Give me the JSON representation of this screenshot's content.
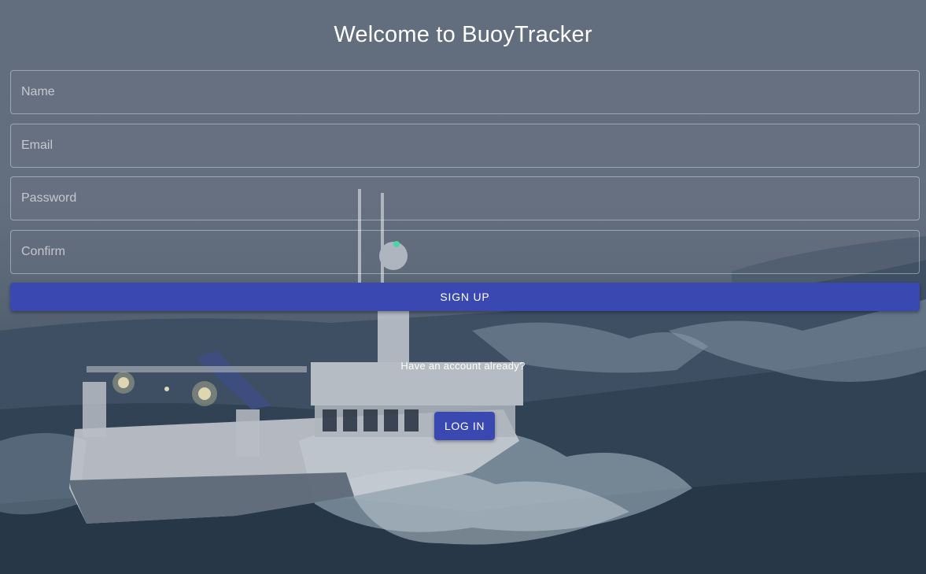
{
  "page": {
    "title": "Welcome to BuoyTracker",
    "background_image": "stormy-sea-fishing-trawler"
  },
  "form": {
    "name_placeholder": "Name",
    "email_placeholder": "Email",
    "password_placeholder": "Password",
    "confirm_placeholder": "Confirm",
    "name_value": "",
    "email_value": "",
    "password_value": "",
    "confirm_value": "",
    "signup_label": "SIGN UP"
  },
  "login": {
    "prompt": "Have an account already?",
    "button_label": "LOG IN"
  },
  "colors": {
    "primary_button": "#3a48b1",
    "text": "#ffffff"
  }
}
